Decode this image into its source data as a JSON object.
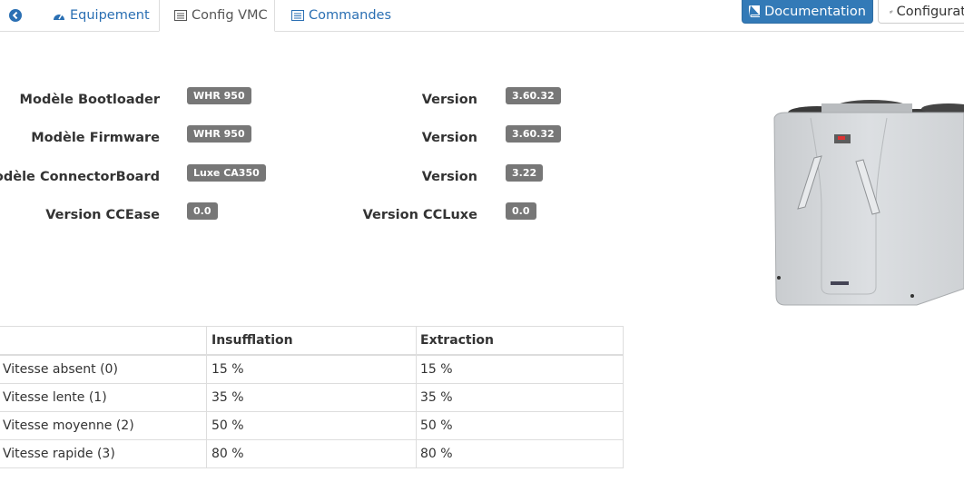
{
  "tabs": {
    "back_icon": "circle-arrow-left-icon",
    "equipement": "Equipement",
    "config_vmc": "Config VMC",
    "commandes": "Commandes"
  },
  "buttons": {
    "documentation": "Documentation",
    "configuration": "Configuration"
  },
  "info": [
    {
      "label": "Modèle Bootloader",
      "value": "WHR 950",
      "version_label": "Version",
      "version": "3.60.32"
    },
    {
      "label": "Modèle Firmware",
      "value": "WHR 950",
      "version_label": "Version",
      "version": "3.60.32"
    },
    {
      "label": "Modèle ConnectorBoard",
      "value": "Luxe CA350",
      "version_label": "Version",
      "version": "3.22"
    },
    {
      "label": "Version CCEase",
      "value": "0.0",
      "version_label": "Version CCLuxe",
      "version": "0.0"
    }
  ],
  "table": {
    "headers": [
      "",
      "Insufflation",
      "Extraction"
    ],
    "rows": [
      [
        "Vitesse absent (0)",
        "15 %",
        "15 %"
      ],
      [
        "Vitesse lente (1)",
        "35 %",
        "35 %"
      ],
      [
        "Vitesse moyenne (2)",
        "50 %",
        "50 %"
      ],
      [
        "Vitesse rapide (3)",
        "80 %",
        "80 %"
      ]
    ]
  },
  "colors": {
    "link": "#2a6fb3",
    "primary_button": "#337ab7",
    "badge": "#777777"
  }
}
